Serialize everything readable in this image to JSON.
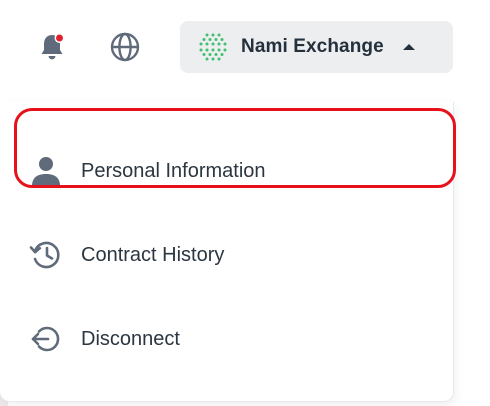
{
  "header": {
    "notification_badge_color": "#e0202e",
    "icons": [
      "bell-icon",
      "globe-icon",
      "chevron-up-icon"
    ]
  },
  "account": {
    "name": "Nami Exchange",
    "avatar": "dotted-green-avatar",
    "avatar_color": "#3fbf6f"
  },
  "menu": {
    "items": [
      {
        "label": "Personal Information",
        "icon": "user-icon"
      },
      {
        "label": "Contract History",
        "icon": "history-icon"
      },
      {
        "label": "Disconnect",
        "icon": "logout-icon"
      }
    ]
  },
  "highlight_color": "#e8101b"
}
